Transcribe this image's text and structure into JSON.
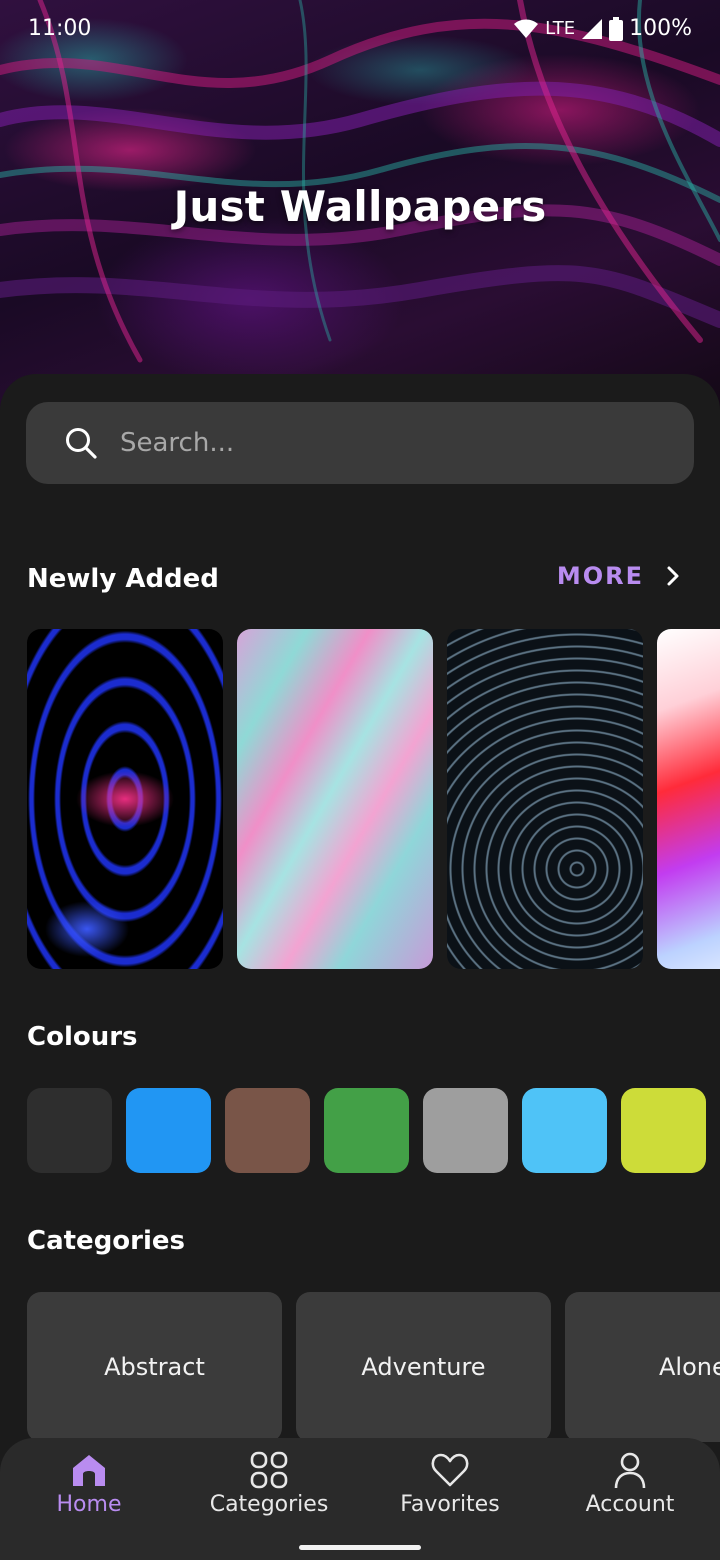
{
  "status_bar": {
    "time": "11:00",
    "network": "LTE",
    "battery": "100%"
  },
  "app": {
    "title": "Just Wallpapers"
  },
  "search": {
    "placeholder": "Search..."
  },
  "newly_added": {
    "title": "Newly Added",
    "more_label": "MORE",
    "thumbnails": [
      "abstract-neon-waves",
      "pastel-fluid-art",
      "star-trails",
      "color-gradient"
    ]
  },
  "colours": {
    "title": "Colours",
    "swatches": [
      "#2e2e2e",
      "#2196f3",
      "#795548",
      "#43a047",
      "#9e9e9e",
      "#4fc3f7",
      "#cddc39"
    ]
  },
  "categories": {
    "title": "Categories",
    "items": [
      "Abstract",
      "Adventure",
      "Alone"
    ]
  },
  "bottom_nav": {
    "items": [
      {
        "label": "Home",
        "icon": "home-icon",
        "active": true
      },
      {
        "label": "Categories",
        "icon": "grid-icon",
        "active": false
      },
      {
        "label": "Favorites",
        "icon": "heart-icon",
        "active": false
      },
      {
        "label": "Account",
        "icon": "person-icon",
        "active": false
      }
    ]
  },
  "colors": {
    "accent": "#b98cf0",
    "background": "#1b1b1b",
    "surface": "#3a3a3a"
  }
}
